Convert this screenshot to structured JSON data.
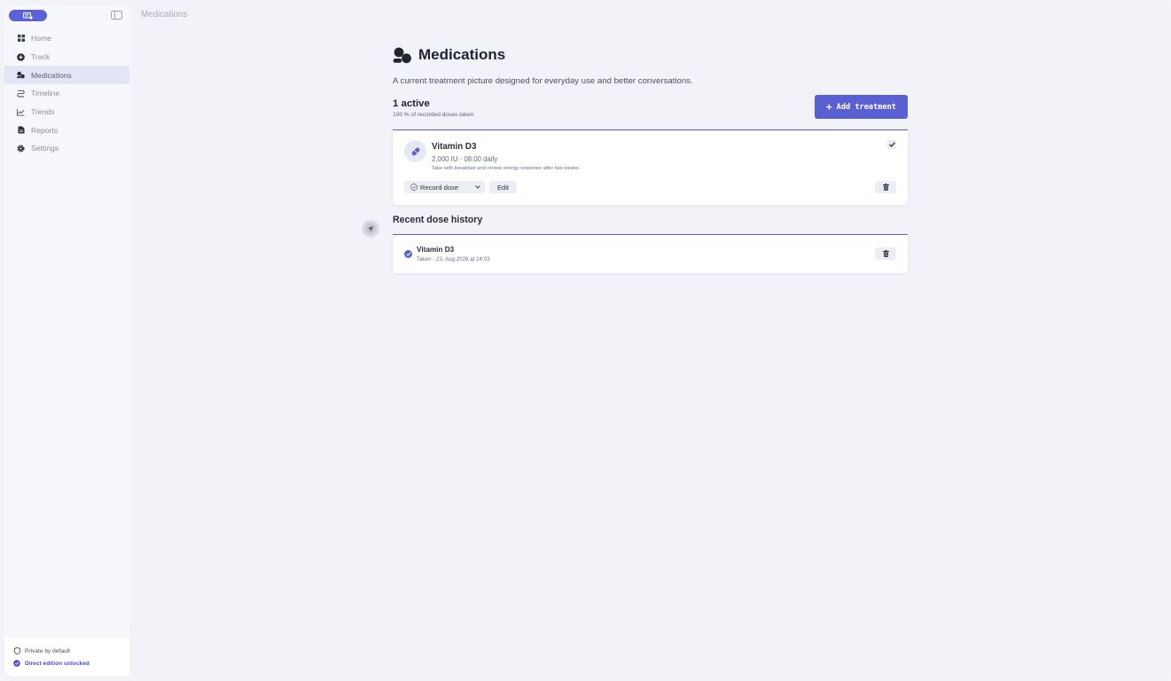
{
  "topbar": {
    "title": "Medications"
  },
  "sidebar": {
    "items": [
      {
        "label": "Home",
        "icon": "grid-icon"
      },
      {
        "label": "Track",
        "icon": "plus-circle-icon"
      },
      {
        "label": "Medications",
        "icon": "pills-icon",
        "active": true
      },
      {
        "label": "Timeline",
        "icon": "route-icon"
      },
      {
        "label": "Trends",
        "icon": "chart-line-icon"
      },
      {
        "label": "Reports",
        "icon": "document-icon"
      },
      {
        "label": "Settings",
        "icon": "gear-icon"
      }
    ],
    "footer": {
      "privacy": "Private by default",
      "edition": "Direct edition unlocked"
    }
  },
  "main": {
    "title": "Medications",
    "subtitle": "A current treatment picture designed for everyday use and better conversations.",
    "summary": {
      "active_count": "1 active",
      "note": "100 % of recorded doses taken"
    },
    "add_button": "Add treatment",
    "medication": {
      "name": "Vitamin D3",
      "dose": "2,000 IU · 08:00 daily",
      "note": "Take with breakfast and review energy response after two weeks.",
      "record_label": "Record dose",
      "edit_label": "Edit"
    },
    "history": {
      "title": "Recent dose history",
      "entries": [
        {
          "name": "Vitamin D3",
          "meta": "Taken · 23. Aug 2026 at 14:03"
        }
      ]
    }
  },
  "colors": {
    "accent": "#5a60d2",
    "background": "#f2f3f9"
  }
}
